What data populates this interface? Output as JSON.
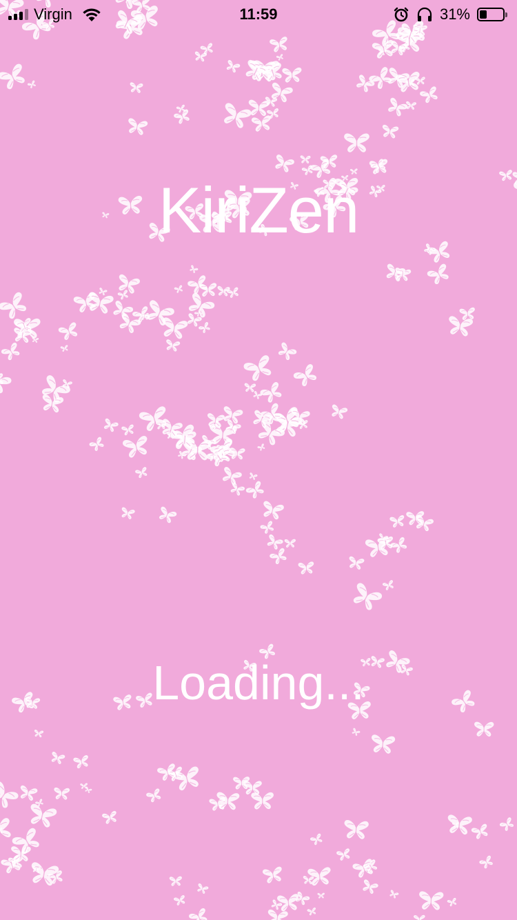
{
  "status_bar": {
    "carrier": "Virgin",
    "time": "11:59",
    "battery_percent": "31%",
    "battery_level": 0.31,
    "signal_bars_active": 3,
    "signal_bars_total": 4,
    "icons": [
      "signal-icon",
      "wifi-icon",
      "alarm-icon",
      "headphones-icon",
      "battery-icon"
    ]
  },
  "app": {
    "title": "KiriZen",
    "loading_text": "Loading..."
  },
  "colors": {
    "background": "#f1aadb",
    "pattern": "#ffffff",
    "text": "#ffffff",
    "status_text": "#000000"
  },
  "background_pattern": "butterfly-icon"
}
